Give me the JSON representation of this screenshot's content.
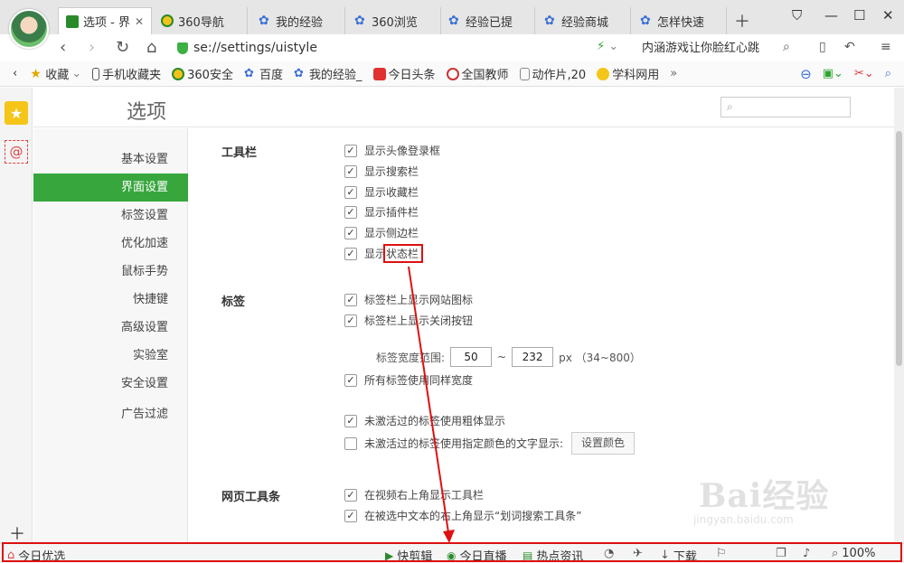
{
  "tabs": [
    {
      "label": "选项 - 界",
      "icon": "wrench-icon",
      "active": true
    },
    {
      "label": "360导航",
      "icon": "360-icon"
    },
    {
      "label": "我的经验",
      "icon": "paw-icon"
    },
    {
      "label": "360浏览",
      "icon": "paw-icon"
    },
    {
      "label": "经验已提",
      "icon": "paw-icon"
    },
    {
      "label": "经验商城",
      "icon": "paw-icon"
    },
    {
      "label": "怎样快速",
      "icon": "paw-icon"
    }
  ],
  "address": {
    "url": "se://settings/uistyle",
    "search_text": "内涵游戏让你脸红心跳"
  },
  "bookmarks": [
    {
      "label": "收藏",
      "icon": "star-icon"
    },
    {
      "label": "手机收藏夹",
      "icon": "phone-icon"
    },
    {
      "label": "360安全",
      "icon": "360-icon"
    },
    {
      "label": "百度",
      "icon": "paw-icon"
    },
    {
      "label": "我的经验_",
      "icon": "paw-icon"
    },
    {
      "label": "今日头条",
      "icon": "news-icon"
    },
    {
      "label": "全国教师",
      "icon": "edu-icon"
    },
    {
      "label": "动作片,20",
      "icon": "doc-icon"
    },
    {
      "label": "学科网用",
      "icon": "face-icon"
    }
  ],
  "settings": {
    "title": "选项",
    "nav": [
      "基本设置",
      "界面设置",
      "标签设置",
      "优化加速",
      "鼠标手势",
      "快捷键",
      "高级设置",
      "实验室",
      "安全设置",
      "广告过滤"
    ],
    "toolbar_section": "工具栏",
    "toolbar_options": [
      "显示头像登录框",
      "显示搜索栏",
      "显示收藏栏",
      "显示插件栏",
      "显示侧边栏",
      "显示状态栏"
    ],
    "tabs_section": "标签",
    "tabs_options": [
      "标签栏上显示网站图标",
      "标签栏上显示关闭按钮"
    ],
    "width_label": "标签宽度范围:",
    "width_min": "50",
    "width_sep": "~",
    "width_max": "232",
    "width_unit": "px （34~800）",
    "same_width": "所有标签使用同样宽度",
    "bold_inactive": "未激活过的标签使用粗体显示",
    "color_inactive": "未激活过的标签使用指定颜色的文字显示:",
    "set_color_button": "设置颜色",
    "web_toolbar_section": "网页工具条",
    "web_toolbar_options": [
      "在视频右上角显示工具栏",
      "在被选中文本的右上角显示“划词搜索工具条”"
    ]
  },
  "statusbar": {
    "left": "今日优选",
    "items": [
      "快剪辑",
      "今日直播",
      "热点资讯",
      "下载"
    ],
    "zoom": "100%"
  },
  "watermark": {
    "brand": "Bai经验",
    "site": "jingyan.baidu.com"
  },
  "colors": {
    "accent": "#37a63d",
    "highlight": "#d11111"
  }
}
